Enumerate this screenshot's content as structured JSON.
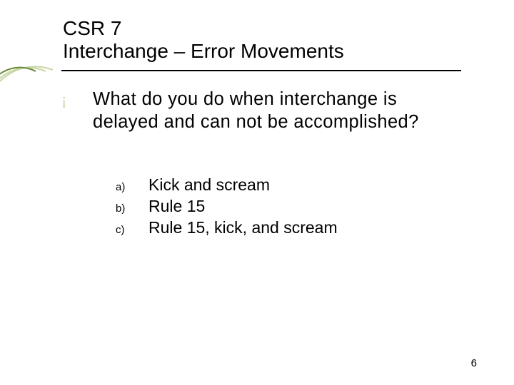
{
  "title": {
    "line1": "CSR 7",
    "line2": "Interchange – Error Movements"
  },
  "bullet": {
    "mark": "¡",
    "question": "What do you do when interchange is delayed and can not be accomplished?"
  },
  "answers": [
    {
      "label": "a)",
      "text": "Kick and scream"
    },
    {
      "label": "b)",
      "text": "Rule 15"
    },
    {
      "label": "c)",
      "text": "Rule 15, kick, and scream"
    }
  ],
  "page_number": "6",
  "colors": {
    "accent_light": "#c9d6a4",
    "accent_dark": "#6a8a3a"
  }
}
